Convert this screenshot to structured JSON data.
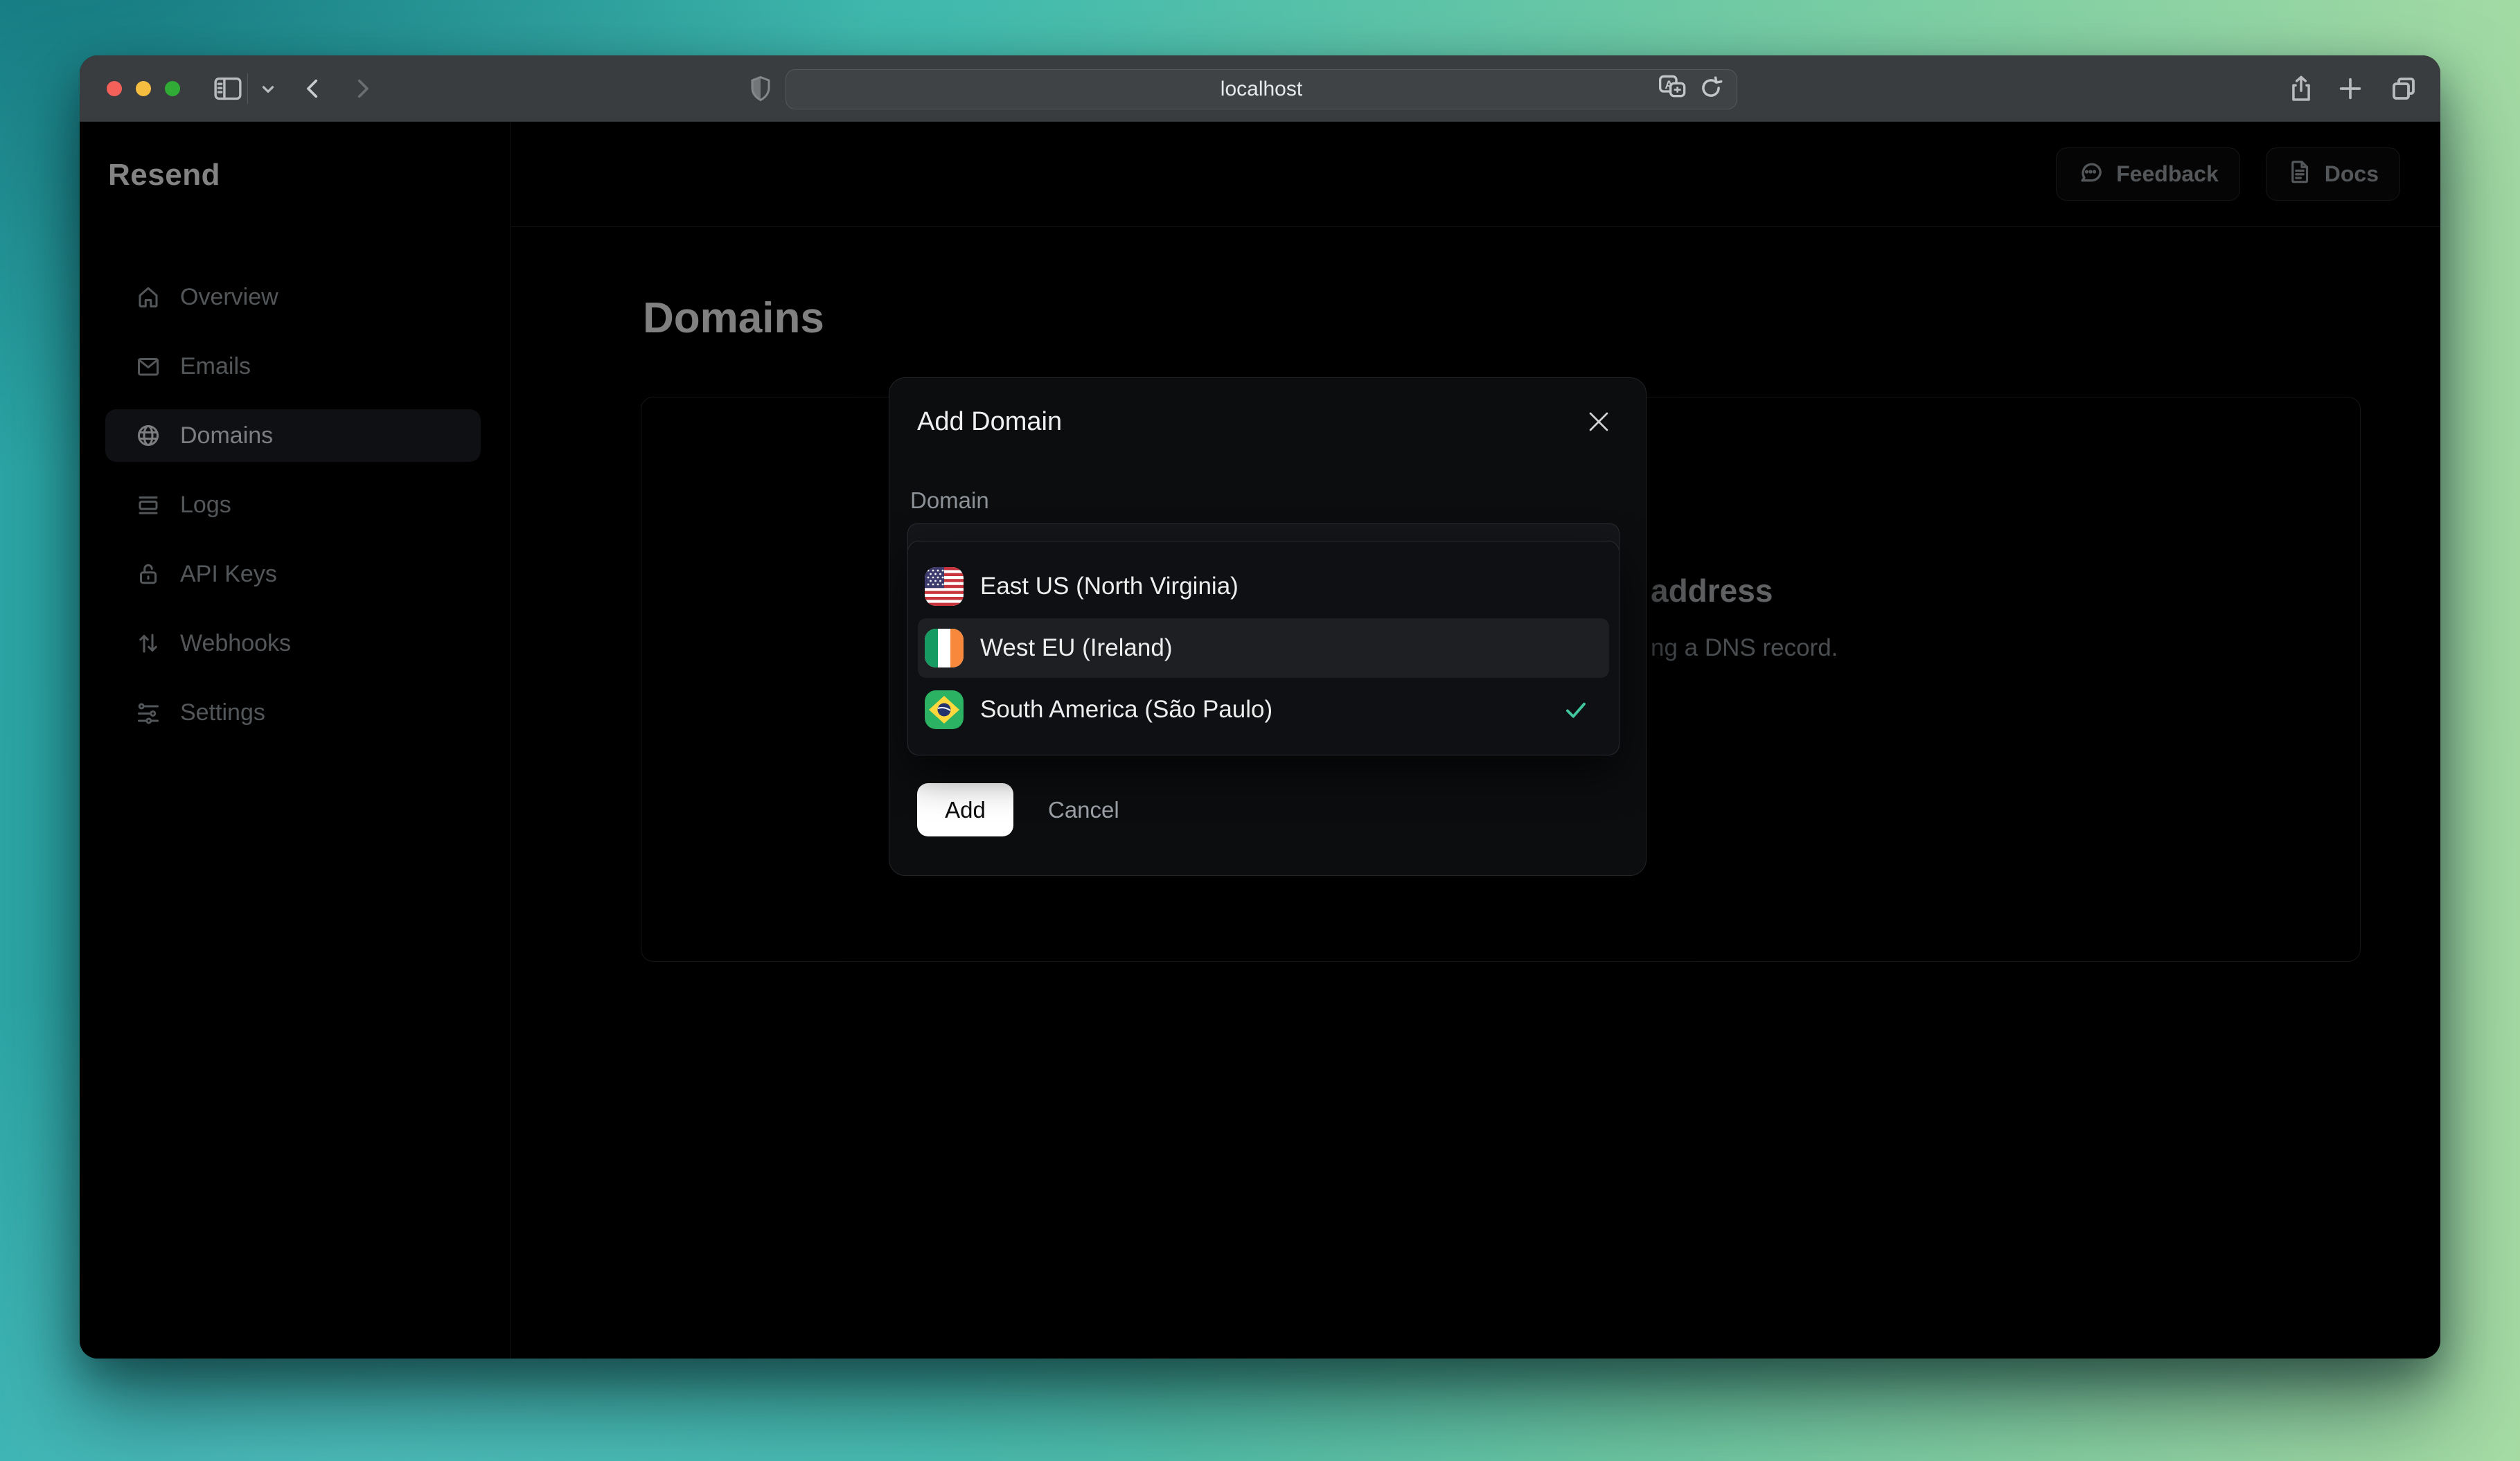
{
  "browser": {
    "url": "localhost",
    "toolbar_icons": [
      "sidebar-toggle-icon",
      "chevron-down-icon",
      "back-icon",
      "forward-icon",
      "shield-icon",
      "translate-icon",
      "reload-icon",
      "share-icon",
      "new-tab-icon",
      "tab-overview-icon"
    ]
  },
  "sidebar": {
    "logo": "Resend",
    "items": [
      {
        "label": "Overview",
        "icon": "home-icon",
        "active": false
      },
      {
        "label": "Emails",
        "icon": "mail-icon",
        "active": false
      },
      {
        "label": "Domains",
        "icon": "globe-icon",
        "active": true
      },
      {
        "label": "Logs",
        "icon": "logs-icon",
        "active": false
      },
      {
        "label": "API Keys",
        "icon": "lock-icon",
        "active": false
      },
      {
        "label": "Webhooks",
        "icon": "arrows-up-down-icon",
        "active": false
      },
      {
        "label": "Settings",
        "icon": "sliders-icon",
        "active": false
      }
    ]
  },
  "header": {
    "feedback_label": "Feedback",
    "docs_label": "Docs"
  },
  "page": {
    "title": "Domains",
    "background_heading_fragment": "address",
    "background_body_fragment": "ng a DNS record."
  },
  "modal": {
    "title": "Add Domain",
    "field_label": "Domain",
    "options": [
      {
        "label": "East US (North Virginia)",
        "flag": "us-flag-icon",
        "highlighted": false,
        "selected": false
      },
      {
        "label": "West EU (Ireland)",
        "flag": "ireland-flag-icon",
        "highlighted": true,
        "selected": false
      },
      {
        "label": "South America (São Paulo)",
        "flag": "brazil-flag-icon",
        "highlighted": false,
        "selected": true
      }
    ],
    "add_label": "Add",
    "cancel_label": "Cancel"
  },
  "colors": {
    "checkmark": "#41c79b",
    "add_button_bg": "#ffffff",
    "modal_bg": "#0c0d0f",
    "page_bg": "#000000",
    "toolbar_bg": "#3a3d40",
    "accent_highlight_row": "#1d1f23"
  }
}
